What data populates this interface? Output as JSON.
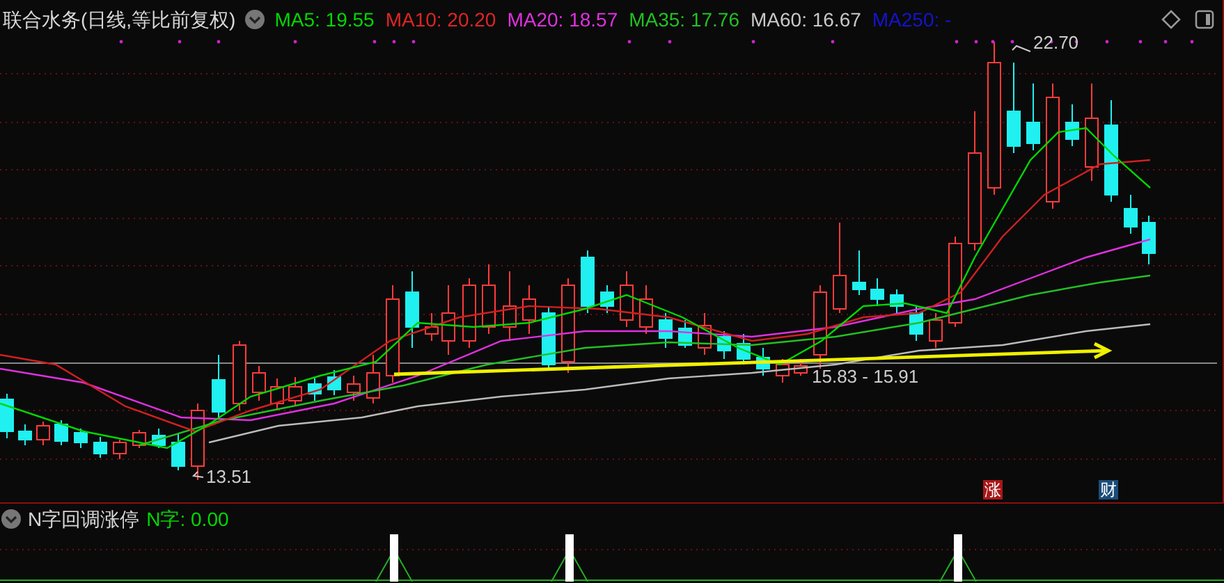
{
  "title": "联合水务(日线,等比前复权)",
  "moving_averages": [
    {
      "label": "MA5: 19.55",
      "color": "#00d800"
    },
    {
      "label": "MA10: 20.20",
      "color": "#e02424"
    },
    {
      "label": "MA20: 18.57",
      "color": "#e030e0"
    },
    {
      "label": "MA35: 17.76",
      "color": "#22c022"
    },
    {
      "label": "MA60: 16.67",
      "color": "#c8c8c8"
    },
    {
      "label": "MA250: -",
      "color": "#1414d0"
    }
  ],
  "price_annotations": [
    {
      "kind": "high",
      "text": "22.70"
    },
    {
      "kind": "low",
      "text": "13.51"
    },
    {
      "kind": "range",
      "text": "15.83 - 15.91"
    }
  ],
  "event_badges": [
    {
      "text": "涨",
      "color": "#a81818"
    },
    {
      "text": "财",
      "color": "#1a4c78"
    }
  ],
  "indicator": {
    "name": "N字回调涨停",
    "values": [
      {
        "label": "N字: 0.00",
        "color": "#00d800"
      }
    ]
  }
}
